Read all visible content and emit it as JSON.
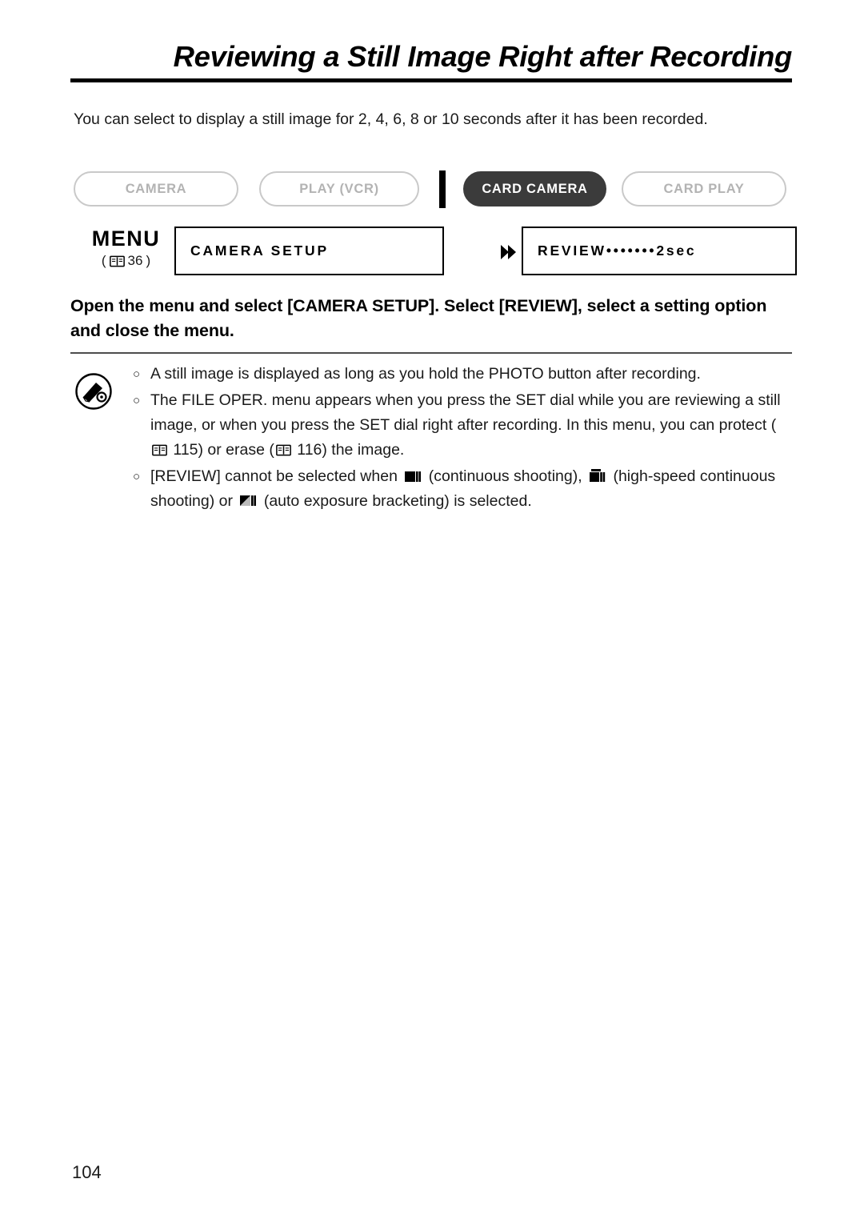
{
  "page": {
    "title": "Reviewing a Still Image Right after Recording",
    "number": "104"
  },
  "intro": "You can select to display a still image for 2, 4, 6, 8 or 10 seconds after it has been recorded.",
  "modes": [
    {
      "label": "CAMERA",
      "active": false
    },
    {
      "label": "PLAY (VCR)",
      "active": false
    },
    {
      "label": "CARD CAMERA",
      "active": true
    },
    {
      "label": "CARD PLAY",
      "active": false
    }
  ],
  "menu": {
    "label": "MENU",
    "reference_open": "(",
    "reference_page": "36",
    "reference_close": ")",
    "boxes": [
      {
        "text": "CAMERA SETUP"
      },
      {
        "text": "REVIEW•••••••2sec"
      }
    ]
  },
  "instruction": "Open the menu and select [CAMERA SETUP]. Select [REVIEW], select a setting option and close the menu.",
  "notes": [
    {
      "bullet": "○",
      "parts": [
        {
          "type": "text",
          "value": "A still image is displayed as long as you hold the PHOTO button after recording."
        }
      ]
    },
    {
      "bullet": "○",
      "parts": [
        {
          "type": "text",
          "value": "The FILE OPER. menu appears when you press the SET dial while you are reviewing a still image, or when you press the SET dial right after recording. In this menu, you can protect ("
        },
        {
          "type": "book-icon"
        },
        {
          "type": "text",
          "value": " 115) or erase ("
        },
        {
          "type": "book-icon"
        },
        {
          "type": "text",
          "value": " 116) the image."
        }
      ]
    },
    {
      "bullet": "○",
      "parts": [
        {
          "type": "text",
          "value": "[REVIEW] cannot be selected when "
        },
        {
          "type": "drive-icon",
          "name": "continuous-shooting-icon"
        },
        {
          "type": "text",
          "value": " (continuous shooting), "
        },
        {
          "type": "drive-icon",
          "name": "high-speed-continuous-shooting-icon"
        },
        {
          "type": "text",
          "value": " (high-speed continuous shooting) or "
        },
        {
          "type": "drive-icon",
          "name": "auto-exposure-bracketing-icon"
        },
        {
          "type": "text",
          "value": " (auto exposure bracketing) is selected."
        }
      ]
    }
  ],
  "colors": {
    "active_mode_bg": "#3b3b3b",
    "inactive_mode_text": "#b3b3b3",
    "inactive_mode_border": "#c9c9c9",
    "body_text": "#1a1a1a"
  }
}
